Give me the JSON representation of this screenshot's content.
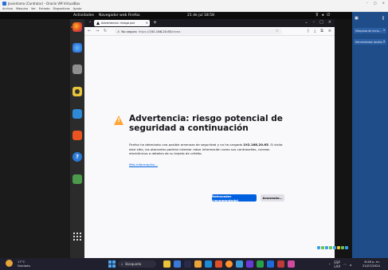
{
  "host": {
    "title": "Javierloma (Controlar) - Oracle VM VirtualBox",
    "menu": [
      "Archivo",
      "Máquina",
      "Ver",
      "Entrada",
      "Dispositivos",
      "Ayuda"
    ]
  },
  "gnome": {
    "activities": "Actividades",
    "app": "Navegador web Firefox",
    "clock": "21 de jul 18:58"
  },
  "firefox": {
    "tab_title": "Advertencia: riesgo pot",
    "url_insecure": "No seguro",
    "url_proto": "https://",
    "url_host": "192.168.20.65",
    "url_path": "/dvwa"
  },
  "warning": {
    "title": "Advertencia: riesgo potencial de seguridad a continuación",
    "desc_before": "Firefox ha detectado una posible amenaza de seguridad y no ha cargado ",
    "desc_host": "192.168.20.65",
    "desc_after": ". Si visita este sitio, los atacantes podrían intentar robar información como sus contraseñas, correos electrónicos o detalles de su tarjeta de crédito.",
    "learn_more": "Más información…",
    "back_button": "Retroceder (recomendado)",
    "advanced_button": "Avanzado…"
  },
  "side_panel": {
    "items": [
      "Máquinas de inicio…",
      "Herramientas locales…"
    ]
  },
  "taskbar": {
    "weather_temp": "17°C",
    "weather_desc": "Nublado",
    "search": "Búsqueda",
    "lang": "ESP",
    "lang2": "LAA",
    "time": "6:28 p. m.",
    "date": "21/07/2024"
  },
  "colors": {
    "accent": "#0061e0",
    "warning": "#ffa436",
    "dock": "#2b2b2b"
  }
}
